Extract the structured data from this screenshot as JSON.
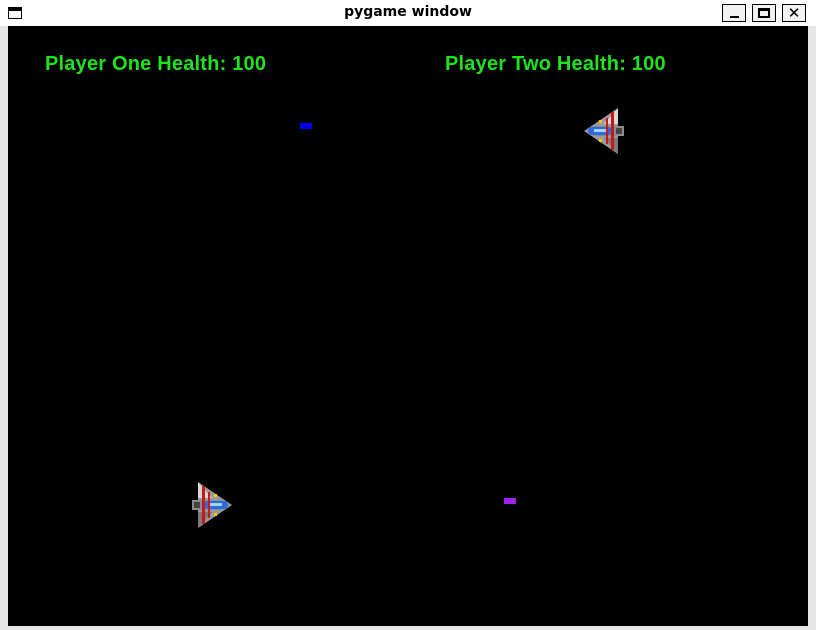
{
  "window": {
    "title": "pygame window",
    "buttons": {
      "minimize": "_",
      "close": "✕"
    }
  },
  "hud": {
    "player_one": "Player One Health: 100",
    "player_two": "Player Two Health: 100",
    "color": "#1ee31e"
  },
  "players": [
    {
      "id": "player-one",
      "health": 100,
      "facing": "right"
    },
    {
      "id": "player-two",
      "health": 100,
      "facing": "left"
    }
  ],
  "bullets": [
    {
      "color": "#0000ee"
    },
    {
      "color": "#a020f0"
    }
  ],
  "colors": {
    "background": "#000000",
    "ship_body": "#9a9a9a",
    "ship_stripes": "#c81818",
    "ship_cockpit": "#2a6be0"
  }
}
